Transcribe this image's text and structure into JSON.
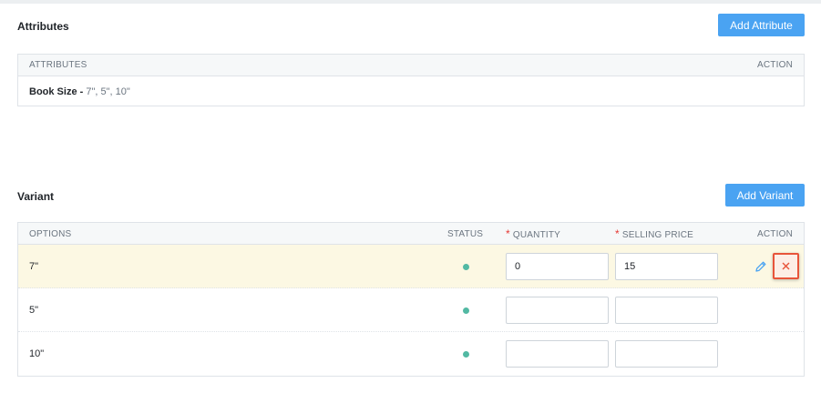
{
  "attributes_section": {
    "title": "Attributes",
    "add_button": "Add Attribute",
    "columns": {
      "attributes": "ATTRIBUTES",
      "action": "ACTION"
    },
    "rows": [
      {
        "name": "Book Size",
        "separator": " - ",
        "values": "7\", 5\", 10\""
      }
    ]
  },
  "variant_section": {
    "title": "Variant",
    "add_button": "Add Variant",
    "columns": {
      "options": "OPTIONS",
      "status": "STATUS",
      "required_marker": "*",
      "quantity": "QUANTITY",
      "selling_price": "SELLING PRICE",
      "action": "ACTION"
    },
    "rows": [
      {
        "option": "7\"",
        "status": "active",
        "quantity": "0",
        "selling_price": "15",
        "highlighted": true
      },
      {
        "option": "5\"",
        "status": "active",
        "quantity": "",
        "selling_price": "",
        "highlighted": false
      },
      {
        "option": "10\"",
        "status": "active",
        "quantity": "",
        "selling_price": "",
        "highlighted": false
      }
    ]
  },
  "icons": {
    "edit": "pencil-icon",
    "delete": "close-icon"
  },
  "colors": {
    "primary": "#4aa3f2",
    "status_active": "#52b9a3",
    "required": "#e53935",
    "delete_border": "#e8543a",
    "highlight_row": "#fcf8e3"
  }
}
